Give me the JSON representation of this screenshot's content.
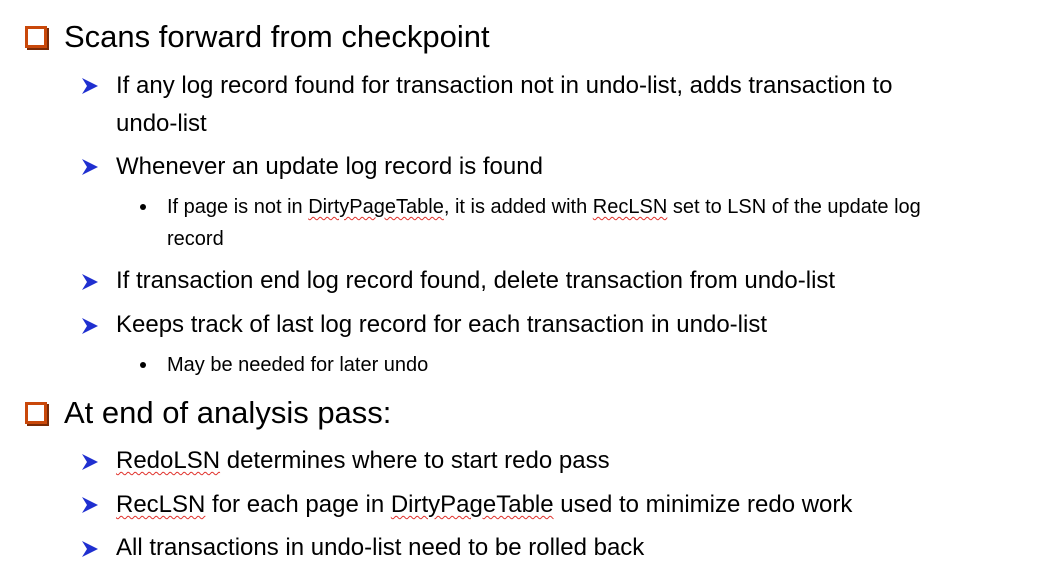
{
  "level1": [
    {
      "text": "Scans forward from checkpoint",
      "icon": "hollow-square-bullet-icon"
    },
    {
      "text": "At end of analysis pass:",
      "icon": "hollow-square-bullet-icon"
    }
  ],
  "s1": [
    {
      "line1": "If any log record found for transaction not in undo-list, adds transaction to",
      "line2": "undo-list"
    },
    {
      "text": "Whenever an update log record is found"
    },
    {
      "pre": "If page is not in ",
      "dpt": "DirtyPageTable",
      "mid": ", it is added with ",
      "rec": "RecLSN",
      "post": " set to LSN of the update log",
      "line2": "record"
    },
    {
      "text": "If transaction end log record found, delete transaction from undo-list"
    },
    {
      "text": "Keeps track of last log record for each transaction in undo-list"
    },
    {
      "text": "May be needed for later undo"
    }
  ],
  "s2": [
    {
      "word": "RedoLSN",
      "rest": " determines where to start redo pass"
    },
    {
      "word": "RecLSN",
      "mid": " for each page in ",
      "word2": "DirtyPageTable",
      "rest": " used to minimize redo work"
    },
    {
      "text": "All transactions in undo-list need to be rolled back"
    }
  ],
  "colors": {
    "square_bullet": "#c9480a",
    "arrow_bullet": "#1f2fd0",
    "spell_underline": "#e0302a"
  }
}
